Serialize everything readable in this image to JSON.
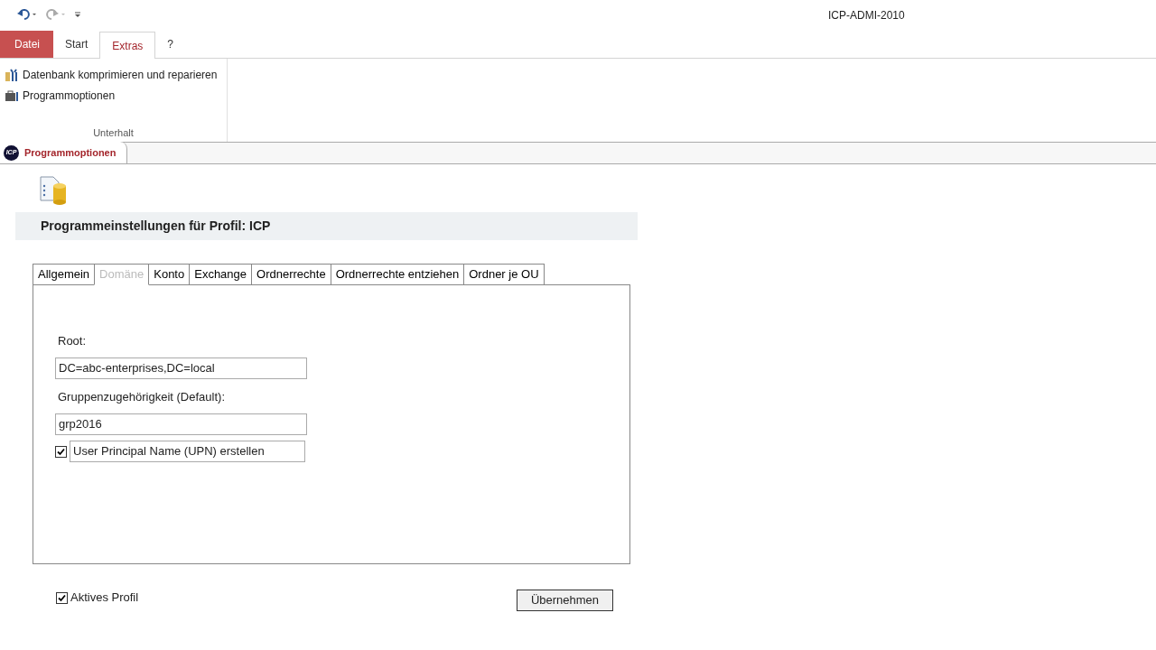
{
  "window": {
    "title": "ICP-ADMI-2010"
  },
  "ribbon_tabs": [
    {
      "label": "Datei",
      "kind": "file"
    },
    {
      "label": "Start",
      "kind": "tab",
      "selected": false
    },
    {
      "label": "Extras",
      "kind": "tab",
      "selected": true
    },
    {
      "label": "?",
      "kind": "tab",
      "selected": false
    }
  ],
  "ribbon_group": {
    "label": "Unterhalt",
    "items": [
      {
        "label": "Datenbank komprimieren und reparieren",
        "kind": "repair"
      },
      {
        "label": "Programmoptionen",
        "kind": "options"
      }
    ]
  },
  "document_tab": {
    "label": "Programmoptionen",
    "logo": "ICP"
  },
  "header": {
    "title": "Programmeinstellungen für Profil: ICP"
  },
  "tabs": [
    {
      "label": "Allgemein",
      "selected": false
    },
    {
      "label": "Domäne",
      "selected": true
    },
    {
      "label": "Konto",
      "selected": false
    },
    {
      "label": "Exchange",
      "selected": false
    },
    {
      "label": "Ordnerrechte",
      "selected": false
    },
    {
      "label": "Ordnerrechte entziehen",
      "selected": false
    },
    {
      "label": "Ordner je OU",
      "selected": false
    }
  ],
  "fields": [
    {
      "label": "Root:",
      "value": "DC=abc-enterprises,DC=local"
    },
    {
      "label": "Gruppenzugehörigkeit (Default):",
      "value": "grp2016"
    }
  ],
  "upn_checkbox": {
    "label": "User Principal Name (UPN) erstellen",
    "checked": true
  },
  "active_profile": {
    "label": "Aktives Profil",
    "checked": true
  },
  "apply_button": {
    "label": "Übernehmen"
  }
}
